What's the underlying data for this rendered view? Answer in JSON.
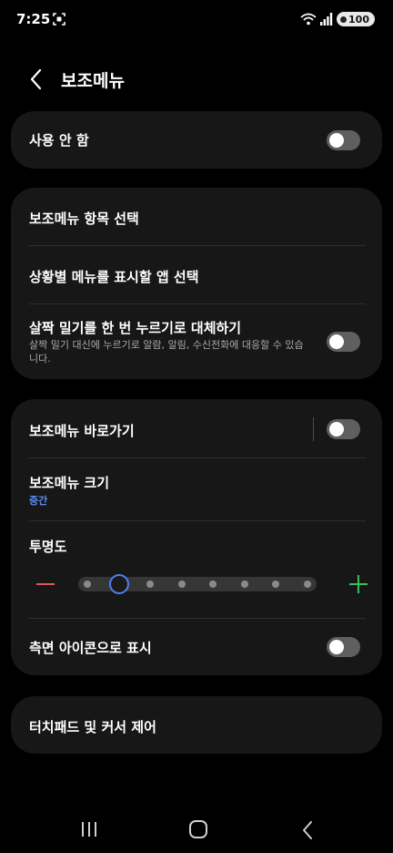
{
  "status_bar": {
    "time": "7:25",
    "battery": "100"
  },
  "header": {
    "title": "보조메뉴"
  },
  "main_switch": {
    "label": "사용 안 함",
    "on": false
  },
  "group1": {
    "items": [
      {
        "label": "보조메뉴 항목 선택"
      },
      {
        "label": "상황별 메뉴를 표시할 앱 선택"
      },
      {
        "label": "살짝 밀기를 한 번 누르기로 대체하기",
        "sub": "살짝 밀기 대신에 누르기로 알람, 알림, 수신전화에 대응할 수 있습니다.",
        "on": false
      }
    ]
  },
  "group2": {
    "shortcut": {
      "label": "보조메뉴 바로가기",
      "on": false
    },
    "size": {
      "label": "보조메뉴 크기",
      "value": "중간"
    },
    "opacity": {
      "label": "투명도",
      "steps": 8,
      "selected_index": 1
    },
    "side_icon": {
      "label": "측면 아이콘으로 표시",
      "on": false
    }
  },
  "group3": {
    "touchpad": {
      "label": "터치패드 및 커서 제어"
    }
  },
  "colors": {
    "background": "#000000",
    "card": "#171717",
    "accent": "#5b8ef0",
    "minus": "#e0575b",
    "plus": "#3bbf5e"
  }
}
